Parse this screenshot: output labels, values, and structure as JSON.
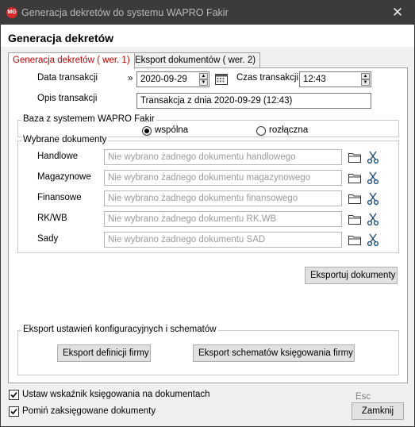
{
  "window": {
    "title": "Generacja dekretów do systemu WAPRO Fakir",
    "icon_text": "MG",
    "close_glyph": "✕"
  },
  "header": {
    "title": "Generacja dekretów"
  },
  "tabs": [
    {
      "label": "Generacja dekretów ( wer. 1)",
      "active": true
    },
    {
      "label": "Eksport dokumentów ( wer. 2)",
      "active": false
    }
  ],
  "transaction": {
    "date_label": "Data transakcji",
    "date_prefix": "»",
    "date_value": "2020-09-29",
    "time_label": "Czas transakcji",
    "time_value": "12:43",
    "desc_label": "Opis transakcji",
    "desc_value": "Transakcja z dnia 2020-09-29 (12:43)"
  },
  "fakir_base": {
    "title": "Baza z systemem WAPRO Fakir",
    "options": [
      {
        "label": "wspólna",
        "selected": true
      },
      {
        "label": "rozłączna",
        "selected": false
      }
    ]
  },
  "selected_docs": {
    "title": "Wybrane dokumenty",
    "rows": [
      {
        "label": "Handlowe",
        "value": "Nie wybrano żadnego dokumentu handlowego"
      },
      {
        "label": "Magazynowe",
        "value": "Nie wybrano żadnego dokumentu magazynowego"
      },
      {
        "label": "Finansowe",
        "value": "Nie wybrano żadnego dokumentu finansowego"
      },
      {
        "label": "RK/WB",
        "value": "Nie wybrano żadnego dokumentu RK,WB"
      },
      {
        "label": "Sady",
        "value": "Nie wybrano żadnego dokumentu SAD"
      }
    ]
  },
  "export_docs_button": "Eksportuj dokumenty",
  "config_export": {
    "title": "Eksport ustawień konfiguracyjnych i schematów",
    "firm_def_button": "Eksport definicji firmy",
    "schemes_button": "Eksport schematów księgowania firmy"
  },
  "footer": {
    "checkbox1": {
      "label": "Ustaw wskaźnik księgowania na dokumentach",
      "checked": true
    },
    "checkbox2": {
      "label": "Pomiń zaksięgowane dokumenty",
      "checked": true
    },
    "esc_hint": "Esc",
    "close_button": "Zamknij"
  }
}
